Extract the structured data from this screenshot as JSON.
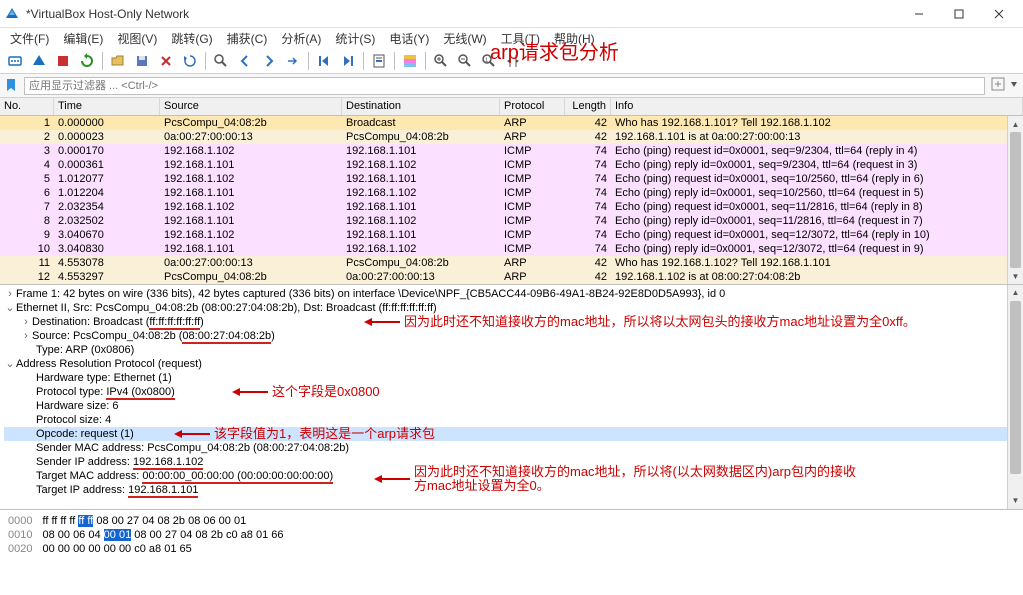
{
  "titlebar": {
    "title": "*VirtualBox Host-Only Network"
  },
  "menu": [
    "文件(F)",
    "编辑(E)",
    "视图(V)",
    "跳转(G)",
    "捕获(C)",
    "分析(A)",
    "统计(S)",
    "电话(Y)",
    "无线(W)",
    "工具(T)",
    "帮助(H)"
  ],
  "filter": {
    "placeholder": "应用显示过滤器 ... <Ctrl-/>"
  },
  "headers": {
    "no": "No.",
    "time": "Time",
    "source": "Source",
    "dest": "Destination",
    "proto": "Protocol",
    "len": "Length",
    "info": "Info"
  },
  "packets": [
    {
      "no": "1",
      "time": "0.000000",
      "src": "PcsCompu_04:08:2b",
      "dst": "Broadcast",
      "proto": "ARP",
      "len": "42",
      "info": "Who has 192.168.1.101? Tell 192.168.1.102",
      "cls": "sel"
    },
    {
      "no": "2",
      "time": "0.000023",
      "src": "0a:00:27:00:00:13",
      "dst": "PcsCompu_04:08:2b",
      "proto": "ARP",
      "len": "42",
      "info": "192.168.1.101 is at 0a:00:27:00:00:13",
      "cls": "arp"
    },
    {
      "no": "3",
      "time": "0.000170",
      "src": "192.168.1.102",
      "dst": "192.168.1.101",
      "proto": "ICMP",
      "len": "74",
      "info": "Echo (ping) request  id=0x0001, seq=9/2304, ttl=64 (reply in 4)",
      "cls": "icmp"
    },
    {
      "no": "4",
      "time": "0.000361",
      "src": "192.168.1.101",
      "dst": "192.168.1.102",
      "proto": "ICMP",
      "len": "74",
      "info": "Echo (ping) reply    id=0x0001, seq=9/2304, ttl=64 (request in 3)",
      "cls": "icmp"
    },
    {
      "no": "5",
      "time": "1.012077",
      "src": "192.168.1.102",
      "dst": "192.168.1.101",
      "proto": "ICMP",
      "len": "74",
      "info": "Echo (ping) request  id=0x0001, seq=10/2560, ttl=64 (reply in 6)",
      "cls": "icmp"
    },
    {
      "no": "6",
      "time": "1.012204",
      "src": "192.168.1.101",
      "dst": "192.168.1.102",
      "proto": "ICMP",
      "len": "74",
      "info": "Echo (ping) reply    id=0x0001, seq=10/2560, ttl=64 (request in 5)",
      "cls": "icmp"
    },
    {
      "no": "7",
      "time": "2.032354",
      "src": "192.168.1.102",
      "dst": "192.168.1.101",
      "proto": "ICMP",
      "len": "74",
      "info": "Echo (ping) request  id=0x0001, seq=11/2816, ttl=64 (reply in 8)",
      "cls": "icmp"
    },
    {
      "no": "8",
      "time": "2.032502",
      "src": "192.168.1.101",
      "dst": "192.168.1.102",
      "proto": "ICMP",
      "len": "74",
      "info": "Echo (ping) reply    id=0x0001, seq=11/2816, ttl=64 (request in 7)",
      "cls": "icmp"
    },
    {
      "no": "9",
      "time": "3.040670",
      "src": "192.168.1.102",
      "dst": "192.168.1.101",
      "proto": "ICMP",
      "len": "74",
      "info": "Echo (ping) request  id=0x0001, seq=12/3072, ttl=64 (reply in 10)",
      "cls": "icmp"
    },
    {
      "no": "10",
      "time": "3.040830",
      "src": "192.168.1.101",
      "dst": "192.168.1.102",
      "proto": "ICMP",
      "len": "74",
      "info": "Echo (ping) reply    id=0x0001, seq=12/3072, ttl=64 (request in 9)",
      "cls": "icmp"
    },
    {
      "no": "11",
      "time": "4.553078",
      "src": "0a:00:27:00:00:13",
      "dst": "PcsCompu_04:08:2b",
      "proto": "ARP",
      "len": "42",
      "info": "Who has 192.168.1.102? Tell 192.168.1.101",
      "cls": "arp"
    },
    {
      "no": "12",
      "time": "4.553297",
      "src": "PcsCompu_04:08:2b",
      "dst": "0a:00:27:00:00:13",
      "proto": "ARP",
      "len": "42",
      "info": "192.168.1.102 is at 08:00:27:04:08:2b",
      "cls": "arp"
    }
  ],
  "details": {
    "frame": "Frame 1: 42 bytes on wire (336 bits), 42 bytes captured (336 bits) on interface \\Device\\NPF_{CB5ACC44-09B6-49A1-8B24-92E8D0D5A993}, id 0",
    "eth": "Ethernet II, Src: PcsCompu_04:08:2b (08:00:27:04:08:2b), Dst: Broadcast (ff:ff:ff:ff:ff:ff)",
    "eth_dst_pre": "Destination: Broadcast (",
    "eth_dst_mac": "ff:ff:ff:ff:ff:ff",
    "eth_dst_post": ")",
    "eth_src_pre": "Source: PcsCompu_04:08:2b (",
    "eth_src_mac": "08:00:27:04:08:2b",
    "eth_src_post": ")",
    "eth_type": "Type: ARP (0x0806)",
    "arp": "Address Resolution Protocol (request)",
    "arp_hw": "Hardware type: Ethernet (1)",
    "arp_proto_pre": "Protocol type: ",
    "arp_proto_val": "IPv4 (0x0800)",
    "arp_hwsize": "Hardware size: 6",
    "arp_psize": "Protocol size: 4",
    "arp_opcode": "Opcode: request (1)",
    "arp_sender_mac": "Sender MAC address: PcsCompu_04:08:2b (08:00:27:04:08:2b)",
    "arp_sender_ip_pre": "Sender IP address: ",
    "arp_sender_ip_val": "192.168.1.102",
    "arp_target_mac_pre": "Target MAC address: ",
    "arp_target_mac_val": "00:00:00_00:00:00 (00:00:00:00:00:00)",
    "arp_target_ip_pre": "Target IP address: ",
    "arp_target_ip_val": "192.168.1.101"
  },
  "hex": {
    "l0_off": "0000",
    "l0a": "ff ff ff ff ",
    "l0b": "ff ff",
    "l0c": " 08 00  27 04 08 2b 08 06 00 01",
    "l1_off": "0010",
    "l1a": "08 00 06 04 ",
    "l1b": "00 01",
    "l1c": " 08 00  27 04 08 2b c0 a8 01 66",
    "l2_off": "0020",
    "l2": "00 00 00 00 00 00 c0 a8  01 65"
  },
  "ann": {
    "title": "arp请求包分析",
    "a1": "因为此时还不知道接收方的mac地址，所以将以太网包头的接收方mac地址设置为全0xff。",
    "a2": "这个字段是0x0800",
    "a3": "该字段值为1，表明这是一个arp请求包",
    "a4a": "因为此时还不知道接收方的mac地址，所以将(以太网数据区内)arp包内的接收",
    "a4b": "方mac地址设置为全0。"
  }
}
